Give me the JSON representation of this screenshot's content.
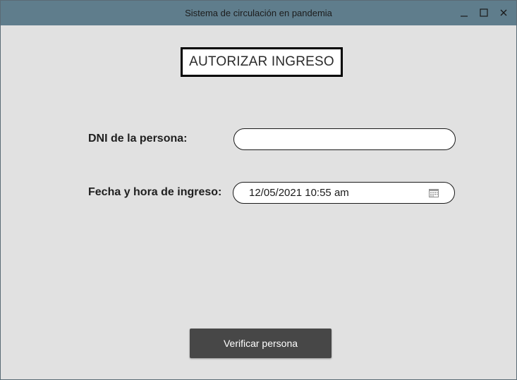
{
  "window": {
    "title": "Sistema de circulación en pandemia",
    "titlebar_color": "#5f7d8c",
    "controls": {
      "minimize_icon": "minimize-icon",
      "maximize_icon": "maximize-icon",
      "close_icon": "close-icon"
    }
  },
  "form": {
    "heading": "AUTORIZAR INGRESO",
    "dni_label": "DNI de la persona:",
    "dni_value": "",
    "fecha_label": "Fecha y hora de ingreso:",
    "fecha_value": "12/05/2021 10:55 am",
    "calendar_icon": "calendar-icon"
  },
  "actions": {
    "verify_label": "Verificar persona",
    "button_color": "#474747"
  },
  "colors": {
    "background": "#e1e1e1",
    "field_background": "#ffffff"
  }
}
